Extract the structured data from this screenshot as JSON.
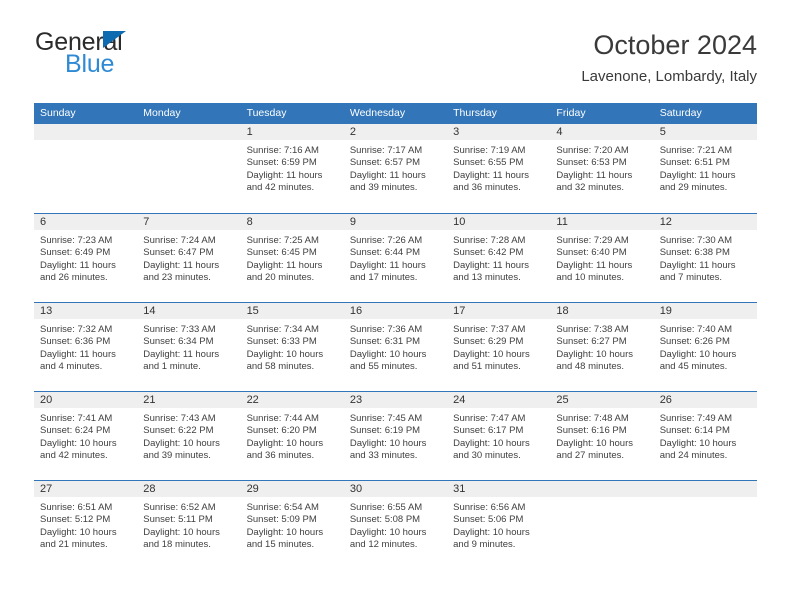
{
  "logo": {
    "word_top": "General",
    "word_bottom": "Blue",
    "triangle_color": "#0f6bb0",
    "blue_text_color": "#2e8ad4"
  },
  "header": {
    "title": "October 2024",
    "subtitle": "Lavenone, Lombardy, Italy"
  },
  "theme": {
    "header_blue": "#3275b8",
    "day_band_gray": "#efefef",
    "text_gray": "#404040"
  },
  "weekdays": [
    "Sunday",
    "Monday",
    "Tuesday",
    "Wednesday",
    "Thursday",
    "Friday",
    "Saturday"
  ],
  "weeks": [
    [
      {
        "day": "",
        "sunrise": "",
        "sunset": "",
        "daylight_line1": "",
        "daylight_line2": ""
      },
      {
        "day": "",
        "sunrise": "",
        "sunset": "",
        "daylight_line1": "",
        "daylight_line2": ""
      },
      {
        "day": "1",
        "sunrise": "Sunrise: 7:16 AM",
        "sunset": "Sunset: 6:59 PM",
        "daylight_line1": "Daylight: 11 hours",
        "daylight_line2": "and 42 minutes."
      },
      {
        "day": "2",
        "sunrise": "Sunrise: 7:17 AM",
        "sunset": "Sunset: 6:57 PM",
        "daylight_line1": "Daylight: 11 hours",
        "daylight_line2": "and 39 minutes."
      },
      {
        "day": "3",
        "sunrise": "Sunrise: 7:19 AM",
        "sunset": "Sunset: 6:55 PM",
        "daylight_line1": "Daylight: 11 hours",
        "daylight_line2": "and 36 minutes."
      },
      {
        "day": "4",
        "sunrise": "Sunrise: 7:20 AM",
        "sunset": "Sunset: 6:53 PM",
        "daylight_line1": "Daylight: 11 hours",
        "daylight_line2": "and 32 minutes."
      },
      {
        "day": "5",
        "sunrise": "Sunrise: 7:21 AM",
        "sunset": "Sunset: 6:51 PM",
        "daylight_line1": "Daylight: 11 hours",
        "daylight_line2": "and 29 minutes."
      }
    ],
    [
      {
        "day": "6",
        "sunrise": "Sunrise: 7:23 AM",
        "sunset": "Sunset: 6:49 PM",
        "daylight_line1": "Daylight: 11 hours",
        "daylight_line2": "and 26 minutes."
      },
      {
        "day": "7",
        "sunrise": "Sunrise: 7:24 AM",
        "sunset": "Sunset: 6:47 PM",
        "daylight_line1": "Daylight: 11 hours",
        "daylight_line2": "and 23 minutes."
      },
      {
        "day": "8",
        "sunrise": "Sunrise: 7:25 AM",
        "sunset": "Sunset: 6:45 PM",
        "daylight_line1": "Daylight: 11 hours",
        "daylight_line2": "and 20 minutes."
      },
      {
        "day": "9",
        "sunrise": "Sunrise: 7:26 AM",
        "sunset": "Sunset: 6:44 PM",
        "daylight_line1": "Daylight: 11 hours",
        "daylight_line2": "and 17 minutes."
      },
      {
        "day": "10",
        "sunrise": "Sunrise: 7:28 AM",
        "sunset": "Sunset: 6:42 PM",
        "daylight_line1": "Daylight: 11 hours",
        "daylight_line2": "and 13 minutes."
      },
      {
        "day": "11",
        "sunrise": "Sunrise: 7:29 AM",
        "sunset": "Sunset: 6:40 PM",
        "daylight_line1": "Daylight: 11 hours",
        "daylight_line2": "and 10 minutes."
      },
      {
        "day": "12",
        "sunrise": "Sunrise: 7:30 AM",
        "sunset": "Sunset: 6:38 PM",
        "daylight_line1": "Daylight: 11 hours",
        "daylight_line2": "and 7 minutes."
      }
    ],
    [
      {
        "day": "13",
        "sunrise": "Sunrise: 7:32 AM",
        "sunset": "Sunset: 6:36 PM",
        "daylight_line1": "Daylight: 11 hours",
        "daylight_line2": "and 4 minutes."
      },
      {
        "day": "14",
        "sunrise": "Sunrise: 7:33 AM",
        "sunset": "Sunset: 6:34 PM",
        "daylight_line1": "Daylight: 11 hours",
        "daylight_line2": "and 1 minute."
      },
      {
        "day": "15",
        "sunrise": "Sunrise: 7:34 AM",
        "sunset": "Sunset: 6:33 PM",
        "daylight_line1": "Daylight: 10 hours",
        "daylight_line2": "and 58 minutes."
      },
      {
        "day": "16",
        "sunrise": "Sunrise: 7:36 AM",
        "sunset": "Sunset: 6:31 PM",
        "daylight_line1": "Daylight: 10 hours",
        "daylight_line2": "and 55 minutes."
      },
      {
        "day": "17",
        "sunrise": "Sunrise: 7:37 AM",
        "sunset": "Sunset: 6:29 PM",
        "daylight_line1": "Daylight: 10 hours",
        "daylight_line2": "and 51 minutes."
      },
      {
        "day": "18",
        "sunrise": "Sunrise: 7:38 AM",
        "sunset": "Sunset: 6:27 PM",
        "daylight_line1": "Daylight: 10 hours",
        "daylight_line2": "and 48 minutes."
      },
      {
        "day": "19",
        "sunrise": "Sunrise: 7:40 AM",
        "sunset": "Sunset: 6:26 PM",
        "daylight_line1": "Daylight: 10 hours",
        "daylight_line2": "and 45 minutes."
      }
    ],
    [
      {
        "day": "20",
        "sunrise": "Sunrise: 7:41 AM",
        "sunset": "Sunset: 6:24 PM",
        "daylight_line1": "Daylight: 10 hours",
        "daylight_line2": "and 42 minutes."
      },
      {
        "day": "21",
        "sunrise": "Sunrise: 7:43 AM",
        "sunset": "Sunset: 6:22 PM",
        "daylight_line1": "Daylight: 10 hours",
        "daylight_line2": "and 39 minutes."
      },
      {
        "day": "22",
        "sunrise": "Sunrise: 7:44 AM",
        "sunset": "Sunset: 6:20 PM",
        "daylight_line1": "Daylight: 10 hours",
        "daylight_line2": "and 36 minutes."
      },
      {
        "day": "23",
        "sunrise": "Sunrise: 7:45 AM",
        "sunset": "Sunset: 6:19 PM",
        "daylight_line1": "Daylight: 10 hours",
        "daylight_line2": "and 33 minutes."
      },
      {
        "day": "24",
        "sunrise": "Sunrise: 7:47 AM",
        "sunset": "Sunset: 6:17 PM",
        "daylight_line1": "Daylight: 10 hours",
        "daylight_line2": "and 30 minutes."
      },
      {
        "day": "25",
        "sunrise": "Sunrise: 7:48 AM",
        "sunset": "Sunset: 6:16 PM",
        "daylight_line1": "Daylight: 10 hours",
        "daylight_line2": "and 27 minutes."
      },
      {
        "day": "26",
        "sunrise": "Sunrise: 7:49 AM",
        "sunset": "Sunset: 6:14 PM",
        "daylight_line1": "Daylight: 10 hours",
        "daylight_line2": "and 24 minutes."
      }
    ],
    [
      {
        "day": "27",
        "sunrise": "Sunrise: 6:51 AM",
        "sunset": "Sunset: 5:12 PM",
        "daylight_line1": "Daylight: 10 hours",
        "daylight_line2": "and 21 minutes."
      },
      {
        "day": "28",
        "sunrise": "Sunrise: 6:52 AM",
        "sunset": "Sunset: 5:11 PM",
        "daylight_line1": "Daylight: 10 hours",
        "daylight_line2": "and 18 minutes."
      },
      {
        "day": "29",
        "sunrise": "Sunrise: 6:54 AM",
        "sunset": "Sunset: 5:09 PM",
        "daylight_line1": "Daylight: 10 hours",
        "daylight_line2": "and 15 minutes."
      },
      {
        "day": "30",
        "sunrise": "Sunrise: 6:55 AM",
        "sunset": "Sunset: 5:08 PM",
        "daylight_line1": "Daylight: 10 hours",
        "daylight_line2": "and 12 minutes."
      },
      {
        "day": "31",
        "sunrise": "Sunrise: 6:56 AM",
        "sunset": "Sunset: 5:06 PM",
        "daylight_line1": "Daylight: 10 hours",
        "daylight_line2": "and 9 minutes."
      },
      {
        "day": "",
        "sunrise": "",
        "sunset": "",
        "daylight_line1": "",
        "daylight_line2": ""
      },
      {
        "day": "",
        "sunrise": "",
        "sunset": "",
        "daylight_line1": "",
        "daylight_line2": ""
      }
    ]
  ]
}
